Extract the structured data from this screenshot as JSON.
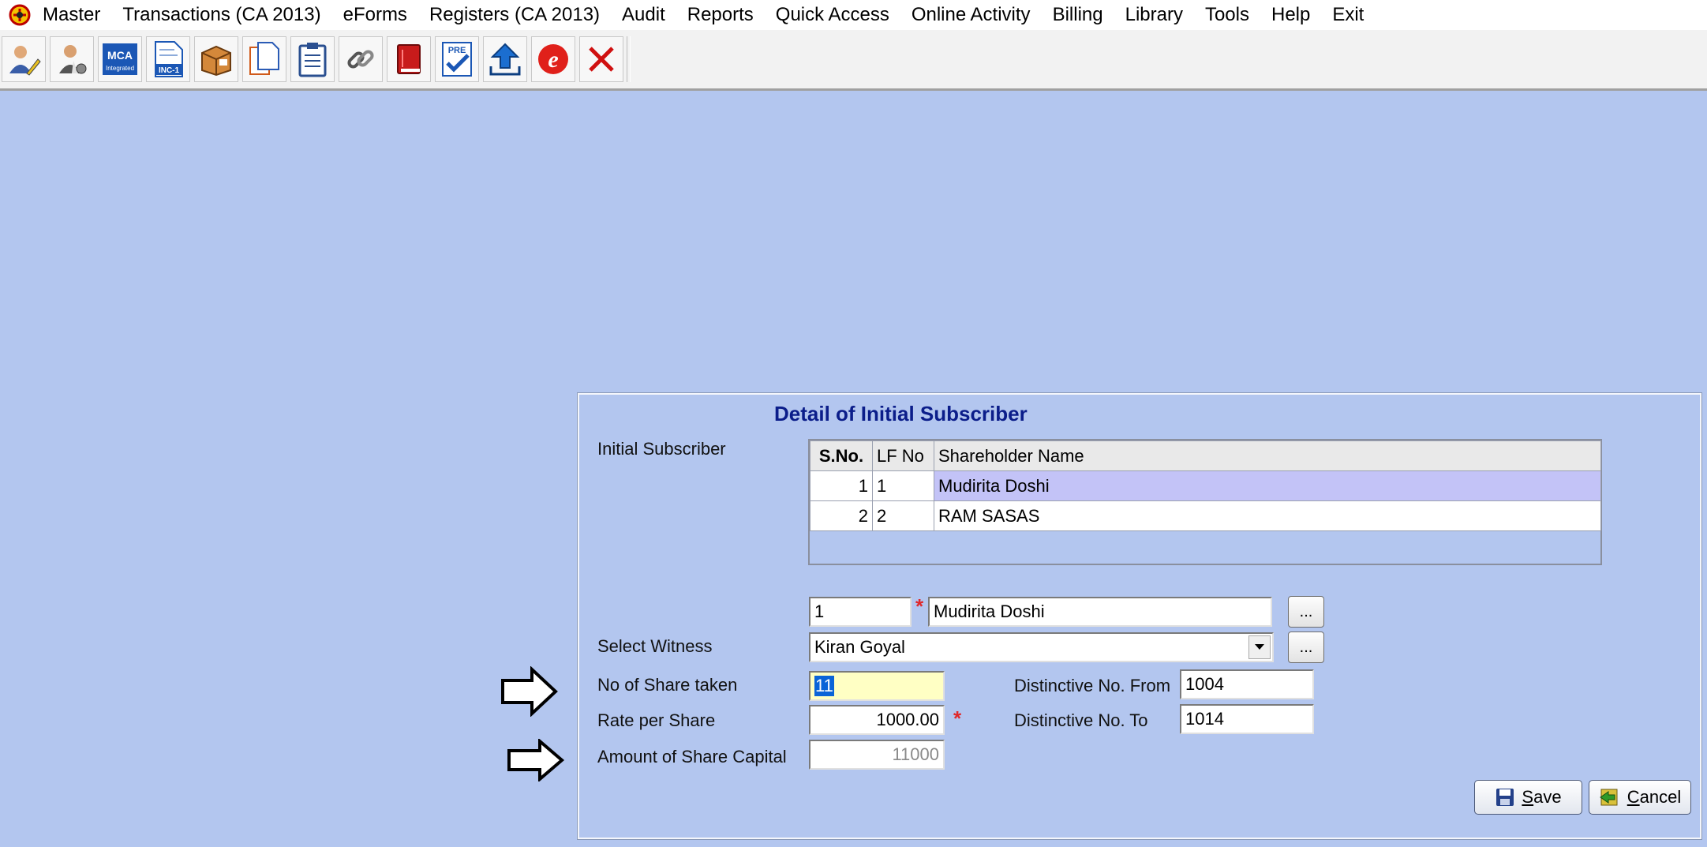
{
  "menu": {
    "items": [
      "Master",
      "Transactions (CA 2013)",
      "eForms",
      "Registers (CA 2013)",
      "Audit",
      "Reports",
      "Quick Access",
      "Online Activity",
      "Billing",
      "Library",
      "Tools",
      "Help",
      "Exit"
    ]
  },
  "toolbar": {
    "buttons": [
      {
        "icon": "user-edit-icon"
      },
      {
        "icon": "user-settings-icon"
      },
      {
        "icon": "mca-integrated-icon",
        "text": "MCA",
        "subtext": "Integrated"
      },
      {
        "icon": "inc1-form-icon",
        "text": "INC-1"
      },
      {
        "icon": "box-package-icon"
      },
      {
        "icon": "documents-icon"
      },
      {
        "icon": "clipboard-icon"
      },
      {
        "icon": "link-chain-icon"
      },
      {
        "icon": "red-book-icon"
      },
      {
        "icon": "pre-check-icon",
        "text": "PRE"
      },
      {
        "icon": "upload-arrow-icon"
      },
      {
        "icon": "e-logo-icon",
        "text": "e"
      },
      {
        "icon": "close-x-icon"
      }
    ]
  },
  "dialog": {
    "title": "Detail of Initial Subscriber",
    "initial_subscriber_label": "Initial Subscriber",
    "grid": {
      "columns": [
        "S.No.",
        "LF No",
        "Shareholder Name"
      ],
      "rows": [
        {
          "sno": "1",
          "lf": "1",
          "name": "Mudirita  Doshi",
          "selected": true
        },
        {
          "sno": "2",
          "lf": "2",
          "name": "RAM  SASAS",
          "selected": false
        }
      ]
    },
    "subscriber_lf": "1",
    "subscriber_name": "Mudirita  Doshi",
    "browse_label": "...",
    "witness_label": "Select Witness",
    "witness_value": "Kiran Goyal",
    "shares_label": "No of Share taken",
    "shares_value": "11",
    "rate_label": "Rate per Share",
    "rate_value": "1000.00",
    "amount_label": "Amount of Share Capital",
    "amount_value": "11000",
    "dist_from_label": "Distinctive No. From",
    "dist_from_value": "1004",
    "dist_to_label": "Distinctive No. To",
    "dist_to_value": "1014",
    "required_mark": "*",
    "save_prefix": "",
    "save_key": "S",
    "save_rest": "ave",
    "cancel_key": "C",
    "cancel_rest": "ancel"
  },
  "colors": {
    "background": "#b3c6ef",
    "title": "#0b1d8a",
    "selected_row": "#c3c3f7",
    "highlight_field": "#ffffc4",
    "required": "#e0282a"
  }
}
